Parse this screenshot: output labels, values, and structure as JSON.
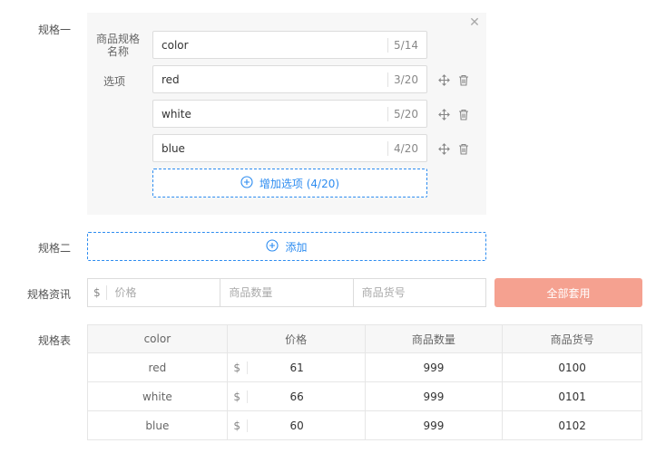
{
  "labels": {
    "spec1": "规格一",
    "spec2": "规格二",
    "spec_info": "规格资讯",
    "spec_table": "规格表"
  },
  "spec_group": {
    "name_label": "商品规格名称",
    "name_value": "color",
    "name_count": "5/14",
    "options_label": "选项",
    "options": [
      {
        "value": "red",
        "count": "3/20"
      },
      {
        "value": "white",
        "count": "5/20"
      },
      {
        "value": "blue",
        "count": "4/20"
      }
    ],
    "add_option_label": "增加选项 (4/20)"
  },
  "add_spec_label": "添加",
  "info": {
    "currency": "$",
    "price_placeholder": "价格",
    "qty_placeholder": "商品数量",
    "sku_placeholder": "商品货号",
    "apply_all_label": "全部套用"
  },
  "table": {
    "headers": [
      "color",
      "价格",
      "商品数量",
      "商品货号"
    ],
    "currency": "$",
    "rows": [
      {
        "color": "red",
        "price": "61",
        "qty": "999",
        "sku": "0100"
      },
      {
        "color": "white",
        "price": "66",
        "qty": "999",
        "sku": "0101"
      },
      {
        "color": "blue",
        "price": "60",
        "qty": "999",
        "sku": "0102"
      }
    ]
  },
  "colors": {
    "accent": "#2d8cf0",
    "apply_button": "#f5a190",
    "panel_bg": "#f7f7f7"
  }
}
